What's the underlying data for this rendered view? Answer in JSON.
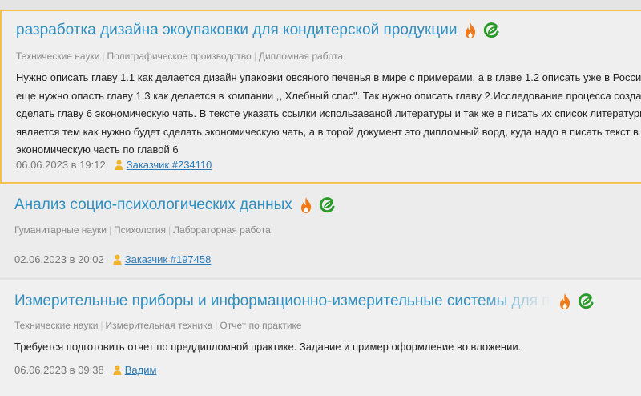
{
  "colors": {
    "link": "#2e8fc0",
    "highlight_border": "#f5c14a",
    "hot": "#f07a1a",
    "eco": "#2a9a2a"
  },
  "orders": [
    {
      "title": "разработка дизайна экоупаковки для кондитерской продукции",
      "categories": [
        "Технические науки",
        "Полиграфическое производство",
        "Дипломная работа"
      ],
      "description": [
        "Нужно описать главу 1.1 как делается дизайн упаковки овсяного печенья в мире с примерами, а в главе 1.2 описать уже в России,",
        "еще нужно опасть главу 1.3 как делается в компании ,, Хлебный спас\". Так нужно описать главу 2.Исследование процесса создани",
        "сделать главу 6 экономическую чать. В тексте указать ссылки использаваной литературы и так же в писать их список литературы.",
        "является тем как нужно будет сделать экономическую чать, а в торой документ это дипломный ворд, куда надо в писать текст в гл",
        "экономическую часть по главой 6"
      ],
      "date": "06.06.2023 в 19:12",
      "client": "Заказчик #234110",
      "icons": [
        "hot-icon",
        "eco-icon"
      ]
    },
    {
      "title": "Анализ социо-психологических данных",
      "categories": [
        "Гуманитарные науки",
        "Психология",
        "Лабораторная работа"
      ],
      "description": [],
      "date": "02.06.2023 в 20:02",
      "client": "Заказчик #197458",
      "icons": [
        "hot-icon",
        "eco-icon"
      ]
    },
    {
      "title": "Измерительные приборы и информационно-измерительные системы для про",
      "categories": [
        "Технические науки",
        "Измерительная техника",
        "Отчет по практике"
      ],
      "description": [
        "Требуется подготовить отчет по преддипломной практике. Задание и пример оформление во вложении."
      ],
      "date": "06.06.2023 в 09:38",
      "client": "Вадим",
      "icons": [
        "hot-icon",
        "eco-icon"
      ]
    }
  ]
}
